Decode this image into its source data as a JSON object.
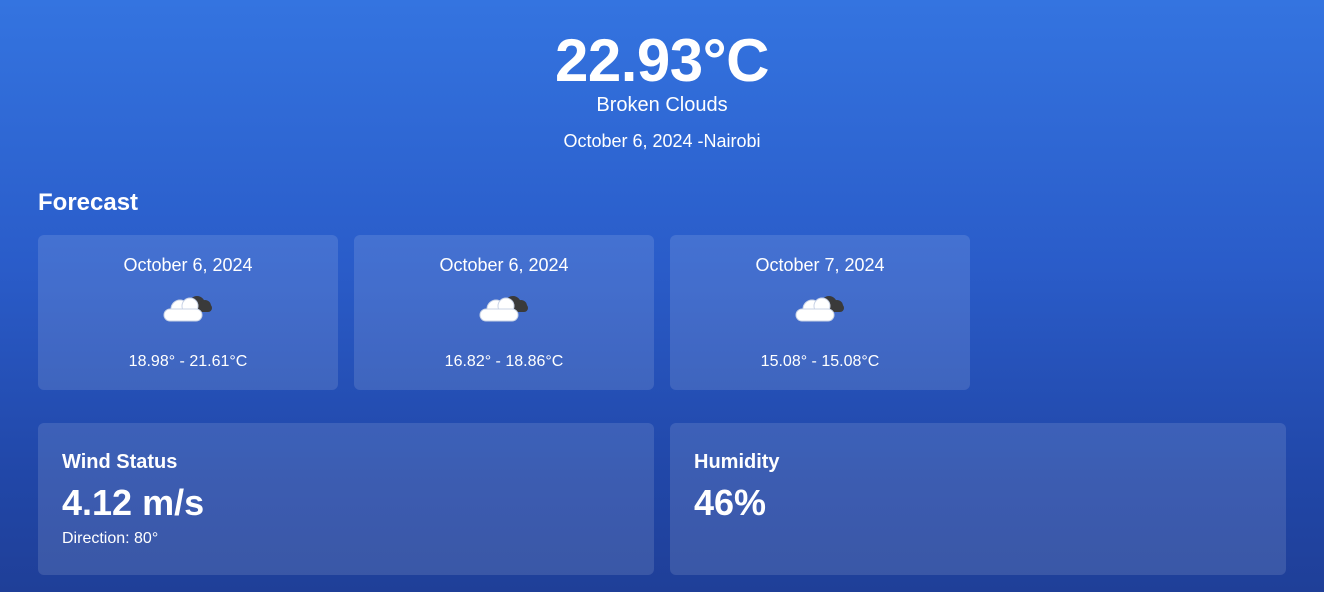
{
  "current": {
    "temperature": "22.93°C",
    "condition": "Broken Clouds",
    "date_location": "October 6, 2024 -Nairobi"
  },
  "forecast": {
    "heading": "Forecast",
    "items": [
      {
        "date": "October 6, 2024",
        "icon": "sun-behind-cloud-icon",
        "range": "18.98° - 21.61°C"
      },
      {
        "date": "October 6, 2024",
        "icon": "sun-behind-cloud-icon",
        "range": "16.82° - 18.86°C"
      },
      {
        "date": "October 7, 2024",
        "icon": "sun-behind-cloud-icon",
        "range": "15.08° - 15.08°C"
      }
    ]
  },
  "wind": {
    "label": "Wind Status",
    "value": "4.12 m/s",
    "direction": "Direction: 80°"
  },
  "humidity": {
    "label": "Humidity",
    "value": "46%"
  },
  "colors": {
    "background_top": "#3474e0",
    "background_bottom": "#1f3f98",
    "card": "rgba(255,255,255,0.12)",
    "text": "#ffffff"
  }
}
